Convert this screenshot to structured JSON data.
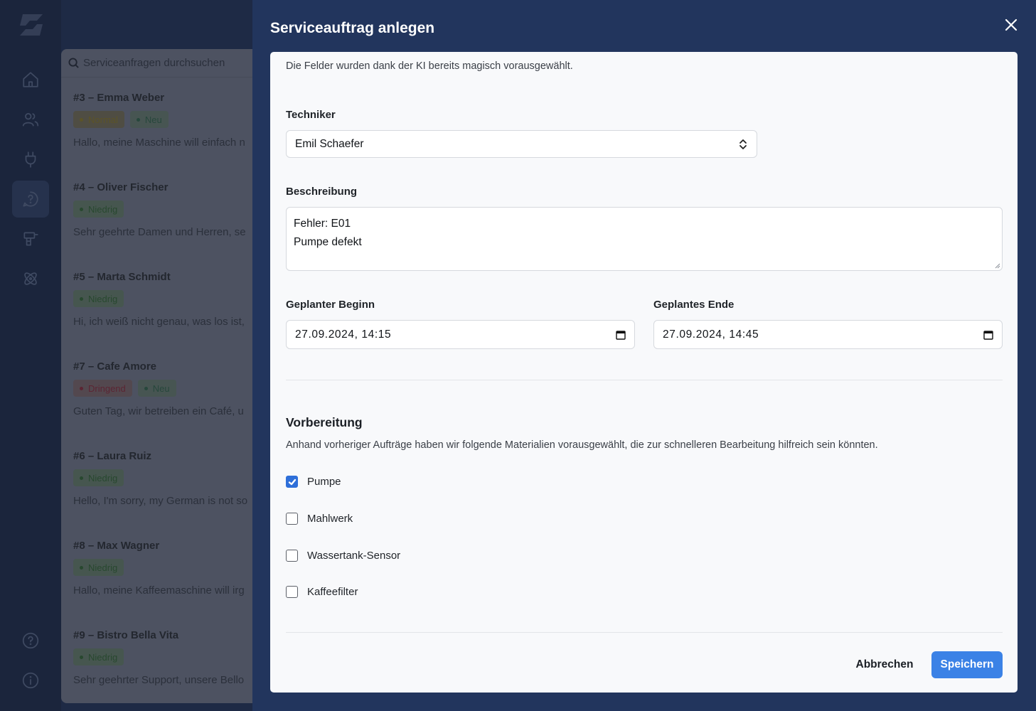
{
  "sidebar": {
    "nav_icons": [
      "home-icon",
      "users-icon",
      "plug-icon",
      "chat-help-icon",
      "drill-icon",
      "atom-icon",
      "help-circle-icon",
      "info-icon"
    ],
    "active": "chat-help-icon"
  },
  "list": {
    "search_placeholder": "Serviceanfragen durchsuchen",
    "items": [
      {
        "title": "#3 – Emma Weber",
        "badges": [
          "Normal",
          "Neu"
        ],
        "preview": "Hallo, meine Maschine will einfach n"
      },
      {
        "title": "#4 – Oliver Fischer",
        "badges": [
          "Niedrig"
        ],
        "preview": "Sehr geehrte Damen und Herren, se"
      },
      {
        "title": "#5 – Marta Schmidt",
        "badges": [
          "Niedrig"
        ],
        "preview": "Hi, ich weiß nicht genau, was los ist,"
      },
      {
        "title": "#7 – Cafe Amore",
        "badges": [
          "Dringend",
          "Neu"
        ],
        "preview": "Guten Tag, wir betreiben ein Café, u"
      },
      {
        "title": "#6 – Laura Ruiz",
        "badges": [
          "Niedrig"
        ],
        "preview": "Hello, I'm sorry, my German is not so"
      },
      {
        "title": "#8 – Max Wagner",
        "badges": [
          "Niedrig"
        ],
        "preview": "Hallo, meine Kaffeemaschine will irg"
      },
      {
        "title": "#9 – Bistro Bella Vita",
        "badges": [
          "Niedrig"
        ],
        "preview": "Sehr geehrter Support, unsere Bello"
      }
    ]
  },
  "modal": {
    "title": "Serviceauftrag anlegen",
    "intro": "Die Felder wurden dank der KI bereits magisch vorausgewählt.",
    "technician_label": "Techniker",
    "technician_value": "Emil Schaefer",
    "description_label": "Beschreibung",
    "description_line1": "Fehler: E01",
    "description_line2": "Pumpe defekt",
    "start_label": "Geplanter Beginn",
    "start_value": "27.09.2024, 14:15",
    "end_label": "Geplantes Ende",
    "end_value": "27.09.2024, 14:45",
    "prep_title": "Vorbereitung",
    "prep_desc": "Anhand vorheriger Aufträge haben wir folgende Materialien vorausgewählt, die zur schnelleren Bearbeitung hilfreich sein könnten.",
    "materials": [
      {
        "label": "Pumpe",
        "checked": true
      },
      {
        "label": "Mahlwerk",
        "checked": false
      },
      {
        "label": "Wassertank-Sensor",
        "checked": false
      },
      {
        "label": "Kaffeefilter",
        "checked": false
      }
    ],
    "cancel_label": "Abbrechen",
    "save_label": "Speichern"
  },
  "colors": {
    "accent": "#3b82e6",
    "modal_bg": "#22355d",
    "checkbox_on": "#2e6fd9"
  }
}
